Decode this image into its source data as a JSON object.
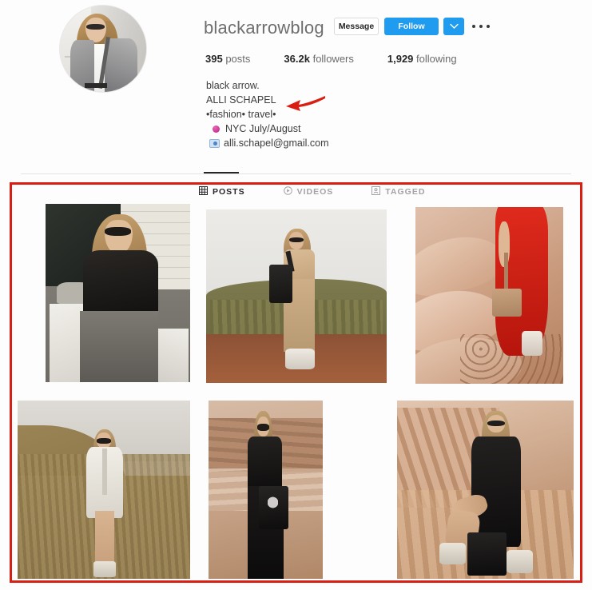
{
  "profile": {
    "username": "blackarrowblog",
    "avatar_alt": "profile-photo"
  },
  "actions": {
    "message_label": "Message",
    "follow_label": "Follow",
    "caret_label": "more-follow-options",
    "more_label": "more-options",
    "accent_blue": "#1f9bf0"
  },
  "stats": [
    {
      "value": "395",
      "label": "posts"
    },
    {
      "value": "36.2k",
      "label": "followers"
    },
    {
      "value": "1,929",
      "label": "following"
    }
  ],
  "bio": {
    "name": "black arrow.",
    "real_name": "ALLI SCHAPEL",
    "tags": "•fashion• travel•",
    "location": "NYC July/August",
    "email": "alli.schapel@gmail.com",
    "pin_icon": "pink-circle-pin-icon",
    "camera_icon": "camera-icon"
  },
  "tabs": [
    {
      "label": "POSTS",
      "icon": "grid-icon",
      "active": true
    },
    {
      "label": "VIDEOS",
      "icon": "play-circle-icon",
      "active": false
    },
    {
      "label": "TAGGED",
      "icon": "tag-person-icon",
      "active": false
    }
  ],
  "annotations": {
    "box_color": "#d91f14",
    "arrow_color": "#d91f14",
    "arrow_name": "red-arrow-pointing-to-bio-tags",
    "box_name": "red-highlight-box-around-post-grid"
  },
  "grid": {
    "rows": [
      {
        "posts": [
          {
            "name": "post-thumbnail-1",
            "alt": "woman in black top and grey pants seated on rooftop"
          },
          {
            "name": "post-thumbnail-2",
            "alt": "woman in beige dress with black bucket bag on hill"
          },
          {
            "name": "post-thumbnail-3",
            "alt": "red dress and tan crossbody bag on pink sand cliff"
          }
        ]
      },
      {
        "posts": [
          {
            "name": "post-thumbnail-4",
            "alt": "woman in white blazer on dry grass hill"
          },
          {
            "name": "post-thumbnail-5",
            "alt": "woman in black top and wide black pants with tote"
          },
          {
            "name": "post-thumbnail-6",
            "alt": "woman in black dress seated on sandstone cliff"
          }
        ]
      }
    ]
  }
}
